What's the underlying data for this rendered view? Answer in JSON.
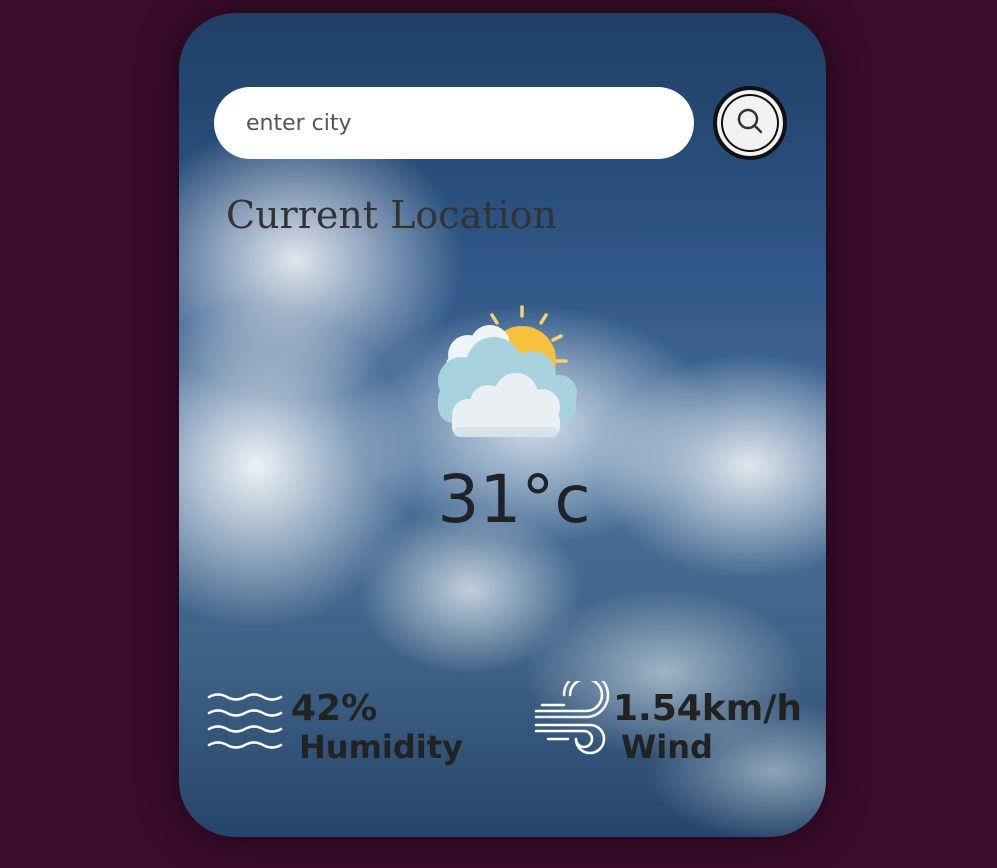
{
  "search": {
    "placeholder": "enter city",
    "button_icon": "search-icon"
  },
  "location": {
    "title": "Current Location"
  },
  "weather": {
    "icon": "partly-cloudy-icon",
    "temperature": "31°c"
  },
  "humidity": {
    "icon": "humidity-icon",
    "value": "42%",
    "label": "Humidity"
  },
  "wind": {
    "icon": "wind-icon",
    "value": "1.54km/h",
    "label": "Wind"
  },
  "colors": {
    "background": "#3b0c2b",
    "sun": "#f6c23e",
    "text": "#222222"
  }
}
